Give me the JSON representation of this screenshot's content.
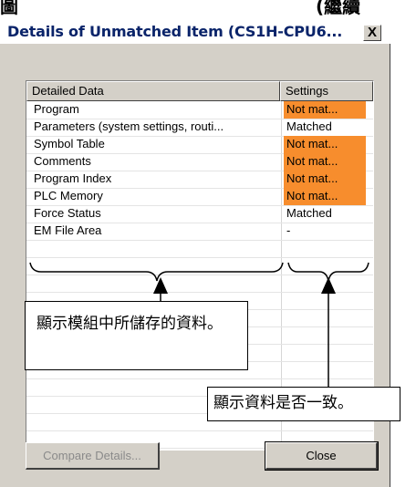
{
  "doc_fragments": {
    "left": "圖",
    "right": "(繼續"
  },
  "dialog": {
    "title": "Details of Unmatched Item (CS1H-CPU6...",
    "close_glyph": "X"
  },
  "table": {
    "headers": {
      "data": "Detailed Data",
      "settings": "Settings"
    },
    "rows": [
      {
        "data": "Program",
        "settings": "Not mat...",
        "unmatched": true
      },
      {
        "data": "Parameters (system settings, routi...",
        "settings": "Matched",
        "unmatched": false
      },
      {
        "data": "Symbol Table",
        "settings": "Not mat...",
        "unmatched": true
      },
      {
        "data": "Comments",
        "settings": "Not mat...",
        "unmatched": true
      },
      {
        "data": "Program Index",
        "settings": "Not mat...",
        "unmatched": true
      },
      {
        "data": "PLC Memory",
        "settings": "Not mat...",
        "unmatched": true
      },
      {
        "data": "Force Status",
        "settings": "Matched",
        "unmatched": false
      },
      {
        "data": "EM File Area",
        "settings": "-",
        "unmatched": false
      }
    ]
  },
  "buttons": {
    "compare": "Compare Details...",
    "close": "Close"
  },
  "callouts": {
    "left": "顯示模組中所儲存的資料。",
    "right": "顯示資料是否一致。"
  },
  "colors": {
    "unmatched_bg": "#f78d2d",
    "title": "#0a246a",
    "dialog_bg": "#d4d0c8"
  }
}
